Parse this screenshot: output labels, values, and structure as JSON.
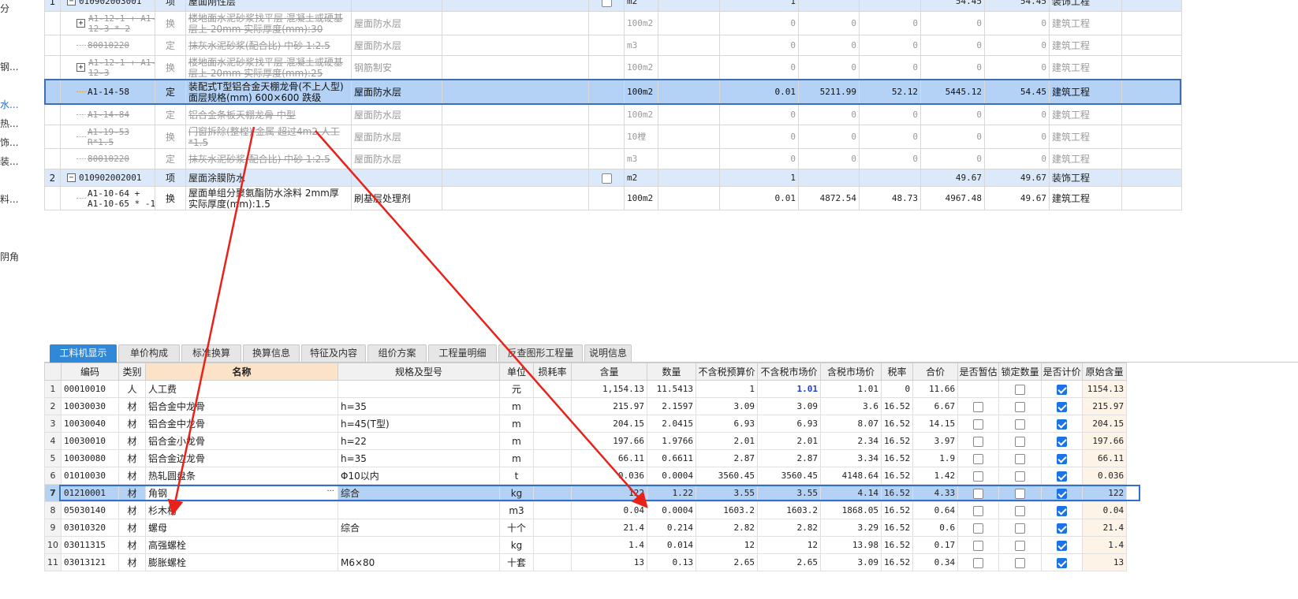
{
  "left_nav": [
    {
      "label": "分",
      "active": false
    },
    {
      "label": "钢...",
      "active": false
    },
    {
      "label": "水...",
      "active": true
    },
    {
      "label": "热...",
      "active": false
    },
    {
      "label": "饰...",
      "active": false
    },
    {
      "label": "装...",
      "active": false
    },
    {
      "label": "料...",
      "active": false
    },
    {
      "label": "阴角",
      "active": false
    }
  ],
  "top_rows": [
    {
      "no": "1",
      "code": "010902003001",
      "cat": "项",
      "name": "屋面刚性层",
      "spec": "",
      "dept": "",
      "check": false,
      "unit": "m2",
      "qty": "1",
      "v1": "",
      "v2": "",
      "v3": "54.45",
      "v4": "54.45",
      "prof": "装饰工程",
      "style": "item",
      "tree": "minus"
    },
    {
      "no": "",
      "code": "A1-12-1 + A1-12-3 * 2",
      "cat": "换",
      "name": "楼地面水泥砂浆找平层 混凝土或硬基层上 20mm  实际厚度(mm):30",
      "spec": "屋面防水层",
      "dept": "",
      "unit": "100m2",
      "qty": "0",
      "v1": "0",
      "v2": "0",
      "v3": "0",
      "v4": "0",
      "prof": "建筑工程",
      "style": "del",
      "tree": "plus"
    },
    {
      "no": "",
      "code": "80010220",
      "cat": "定",
      "name": "抹灰水泥砂浆(配合比) 中砂 1:2.5",
      "spec": "屋面防水层",
      "dept": "",
      "unit": "m3",
      "qty": "0",
      "v1": "0",
      "v2": "0",
      "v3": "0",
      "v4": "0",
      "prof": "建筑工程",
      "style": "del",
      "tree": "line"
    },
    {
      "no": "",
      "code": "A1-12-1 + A1-12-3",
      "cat": "换",
      "name": "楼地面水泥砂浆找平层 混凝土或硬基层上 20mm  实际厚度(mm):25",
      "spec": "钢筋制安",
      "dept": "",
      "unit": "100m2",
      "qty": "0",
      "v1": "0",
      "v2": "0",
      "v3": "0",
      "v4": "0",
      "prof": "建筑工程",
      "style": "del",
      "tree": "plus"
    },
    {
      "no": "",
      "code": "A1-14-58",
      "cat": "定",
      "name": "装配式T型铝合金天棚龙骨(不上人型) 面层规格(mm) 600×600 跌级",
      "spec": "屋面防水层",
      "dept": "",
      "unit": "100m2",
      "qty": "0.01",
      "v1": "5211.99",
      "v2": "52.12",
      "v3": "5445.12",
      "v4": "54.45",
      "prof": "建筑工程",
      "style": "sel",
      "tree": "line"
    },
    {
      "no": "",
      "code": "A1-14-84",
      "cat": "定",
      "name": "铝合金条板天棚龙骨 中型",
      "spec": "屋面防水层",
      "dept": "",
      "unit": "100m2",
      "qty": "0",
      "v1": "0",
      "v2": "0",
      "v3": "0",
      "v4": "0",
      "prof": "建筑工程",
      "style": "del",
      "tree": "line"
    },
    {
      "no": "",
      "code": "A1-19-53 R*1.5",
      "cat": "换",
      "name": "门窗拆除(整樘) 金属  超过4m2 人工*1.5",
      "spec": "屋面防水层",
      "dept": "",
      "unit": "10樘",
      "qty": "0",
      "v1": "0",
      "v2": "0",
      "v3": "0",
      "v4": "0",
      "prof": "建筑工程",
      "style": "del",
      "tree": "line"
    },
    {
      "no": "",
      "code": "80010220",
      "cat": "定",
      "name": "抹灰水泥砂浆(配合比) 中砂 1:2.5",
      "spec": "屋面防水层",
      "dept": "",
      "unit": "m3",
      "qty": "0",
      "v1": "0",
      "v2": "0",
      "v3": "0",
      "v4": "0",
      "prof": "建筑工程",
      "style": "del",
      "tree": "last"
    },
    {
      "no": "2",
      "code": "010902002001",
      "cat": "项",
      "name": "屋面涂膜防水",
      "spec": "",
      "dept": "",
      "check": false,
      "unit": "m2",
      "qty": "1",
      "v1": "",
      "v2": "",
      "v3": "49.67",
      "v4": "49.67",
      "prof": "装饰工程",
      "style": "item",
      "tree": "minus"
    },
    {
      "no": "",
      "code": "A1-10-64 + A1-10-65 * -1",
      "cat": "换",
      "name": "屋面单组分聚氨酯防水涂料 2mm厚  实际厚度(mm):1.5",
      "spec": "刷基层处理剂",
      "dept": "",
      "unit": "100m2",
      "qty": "0.01",
      "v1": "4872.54",
      "v2": "48.73",
      "v3": "4967.48",
      "v4": "49.67",
      "prof": "建筑工程",
      "style": "normal",
      "tree": "last"
    }
  ],
  "tabs": [
    {
      "label": "工料机显示",
      "active": true
    },
    {
      "label": "单价构成",
      "active": false
    },
    {
      "label": "标准换算",
      "active": false
    },
    {
      "label": "换算信息",
      "active": false
    },
    {
      "label": "特征及内容",
      "active": false
    },
    {
      "label": "组价方案",
      "active": false
    },
    {
      "label": "工程量明细",
      "active": false
    },
    {
      "label": "反查图形工程量",
      "active": false
    },
    {
      "label": "说明信息",
      "active": false
    }
  ],
  "bottom_headers": [
    "",
    "编码",
    "类别",
    "名称",
    "规格及型号",
    "单位",
    "损耗率",
    "含量",
    "数量",
    "不含税预算价",
    "不含税市场价",
    "含税市场价",
    "税率",
    "合价",
    "是否暂估",
    "锁定数量",
    "是否计价",
    "原始含量"
  ],
  "bottom_rows": [
    {
      "n": "1",
      "code": "00010010",
      "cat": "人",
      "name": "人工费",
      "spec": "",
      "unit": "元",
      "loss": "",
      "content": "1,154.13",
      "qty": "11.5413",
      "p1": "1",
      "p2": "1.01",
      "p3": "1.01",
      "tax": "0",
      "total": "11.66",
      "temp": null,
      "lock": false,
      "price": true,
      "orig": "1154.13"
    },
    {
      "n": "2",
      "code": "10030030",
      "cat": "材",
      "name": "铝合金中龙骨",
      "spec": "h=35",
      "unit": "m",
      "loss": "",
      "content": "215.97",
      "qty": "2.1597",
      "p1": "3.09",
      "p2": "3.09",
      "p3": "3.6",
      "tax": "16.52",
      "total": "6.67",
      "temp": false,
      "lock": false,
      "price": true,
      "orig": "215.97"
    },
    {
      "n": "3",
      "code": "10030040",
      "cat": "材",
      "name": "铝合金中龙骨",
      "spec": "h=45(T型)",
      "unit": "m",
      "loss": "",
      "content": "204.15",
      "qty": "2.0415",
      "p1": "6.93",
      "p2": "6.93",
      "p3": "8.07",
      "tax": "16.52",
      "total": "14.15",
      "temp": false,
      "lock": false,
      "price": true,
      "orig": "204.15"
    },
    {
      "n": "4",
      "code": "10030010",
      "cat": "材",
      "name": "铝合金小龙骨",
      "spec": "h=22",
      "unit": "m",
      "loss": "",
      "content": "197.66",
      "qty": "1.9766",
      "p1": "2.01",
      "p2": "2.01",
      "p3": "2.34",
      "tax": "16.52",
      "total": "3.97",
      "temp": false,
      "lock": false,
      "price": true,
      "orig": "197.66"
    },
    {
      "n": "5",
      "code": "10030080",
      "cat": "材",
      "name": "铝合金边龙骨",
      "spec": "h=35",
      "unit": "m",
      "loss": "",
      "content": "66.11",
      "qty": "0.6611",
      "p1": "2.87",
      "p2": "2.87",
      "p3": "3.34",
      "tax": "16.52",
      "total": "1.9",
      "temp": false,
      "lock": false,
      "price": true,
      "orig": "66.11"
    },
    {
      "n": "6",
      "code": "01010030",
      "cat": "材",
      "name": "热轧圆盘条",
      "spec": "Φ10以内",
      "unit": "t",
      "loss": "",
      "content": "0.036",
      "qty": "0.0004",
      "p1": "3560.45",
      "p2": "3560.45",
      "p3": "4148.64",
      "tax": "16.52",
      "total": "1.42",
      "temp": false,
      "lock": false,
      "price": true,
      "orig": "0.036"
    },
    {
      "n": "7",
      "code": "01210001",
      "cat": "材",
      "name": "角钢",
      "spec": "综合",
      "unit": "kg",
      "loss": "",
      "content": "122",
      "qty": "1.22",
      "p1": "3.55",
      "p2": "3.55",
      "p3": "4.14",
      "tax": "16.52",
      "total": "4.33",
      "temp": false,
      "lock": false,
      "price": true,
      "orig": "122",
      "selected": true
    },
    {
      "n": "8",
      "code": "05030140",
      "cat": "材",
      "name": "杉木枋",
      "spec": "",
      "unit": "m3",
      "loss": "",
      "content": "0.04",
      "qty": "0.0004",
      "p1": "1603.2",
      "p2": "1603.2",
      "p3": "1868.05",
      "tax": "16.52",
      "total": "0.64",
      "temp": false,
      "lock": false,
      "price": true,
      "orig": "0.04"
    },
    {
      "n": "9",
      "code": "03010320",
      "cat": "材",
      "name": "螺母",
      "spec": "综合",
      "unit": "十个",
      "loss": "",
      "content": "21.4",
      "qty": "0.214",
      "p1": "2.82",
      "p2": "2.82",
      "p3": "3.29",
      "tax": "16.52",
      "total": "0.6",
      "temp": false,
      "lock": false,
      "price": true,
      "orig": "21.4"
    },
    {
      "n": "10",
      "code": "03011315",
      "cat": "材",
      "name": "高强螺栓",
      "spec": "",
      "unit": "kg",
      "loss": "",
      "content": "1.4",
      "qty": "0.014",
      "p1": "12",
      "p2": "12",
      "p3": "13.98",
      "tax": "16.52",
      "total": "0.17",
      "temp": false,
      "lock": false,
      "price": true,
      "orig": "1.4"
    },
    {
      "n": "11",
      "code": "03013121",
      "cat": "材",
      "name": "膨胀螺栓",
      "spec": "M6×80",
      "unit": "十套",
      "loss": "",
      "content": "13",
      "qty": "0.13",
      "p1": "2.65",
      "p2": "2.65",
      "p3": "3.09",
      "tax": "16.52",
      "total": "0.34",
      "temp": false,
      "lock": false,
      "price": true,
      "orig": "13"
    }
  ],
  "ellipsis": "···",
  "colors": {
    "arrow": "#e8221b",
    "tab_active": "#2f88d8",
    "selected_row": "#b3d2f5",
    "item_row": "#dbe9fb",
    "check_on": "#1a73e8"
  }
}
